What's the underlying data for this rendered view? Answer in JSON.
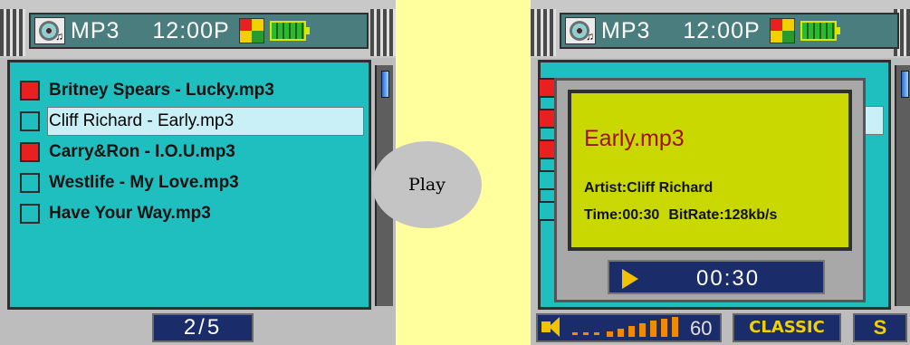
{
  "header": {
    "app_title": "MP3",
    "time": "12:00P",
    "battery_icon": "battery-icon",
    "status_icon": "quad-color-icon"
  },
  "left_screen": {
    "tracks": [
      {
        "name": "Britney Spears - Lucky.mp3",
        "checked": true
      },
      {
        "name": "Cliff Richard - Early.mp3",
        "checked": false,
        "selected": true
      },
      {
        "name": "Carry&Ron - I.O.U.mp3",
        "checked": true
      },
      {
        "name": "Westlife - My Love.mp3",
        "checked": false
      },
      {
        "name": "Have Your Way.mp3",
        "checked": false
      }
    ],
    "page_indicator": "2/5"
  },
  "action": {
    "label": "Play"
  },
  "right_screen": {
    "now_playing": {
      "title": "Early.mp3",
      "artist": "Artist:Cliff Richard",
      "time": "Time:00:30",
      "bitrate": "BitRate:128kb/s",
      "elapsed": "00:30"
    },
    "volume": "60",
    "eq_mode": "CLASSIC",
    "mode_icon": "S"
  },
  "colors": {
    "background": "#ffff9e",
    "screen": "#1fbfbf",
    "popup": "#c8d800",
    "song_title": "#a01010",
    "display_box": "#1a2c6a",
    "accent": "#f2c200"
  }
}
